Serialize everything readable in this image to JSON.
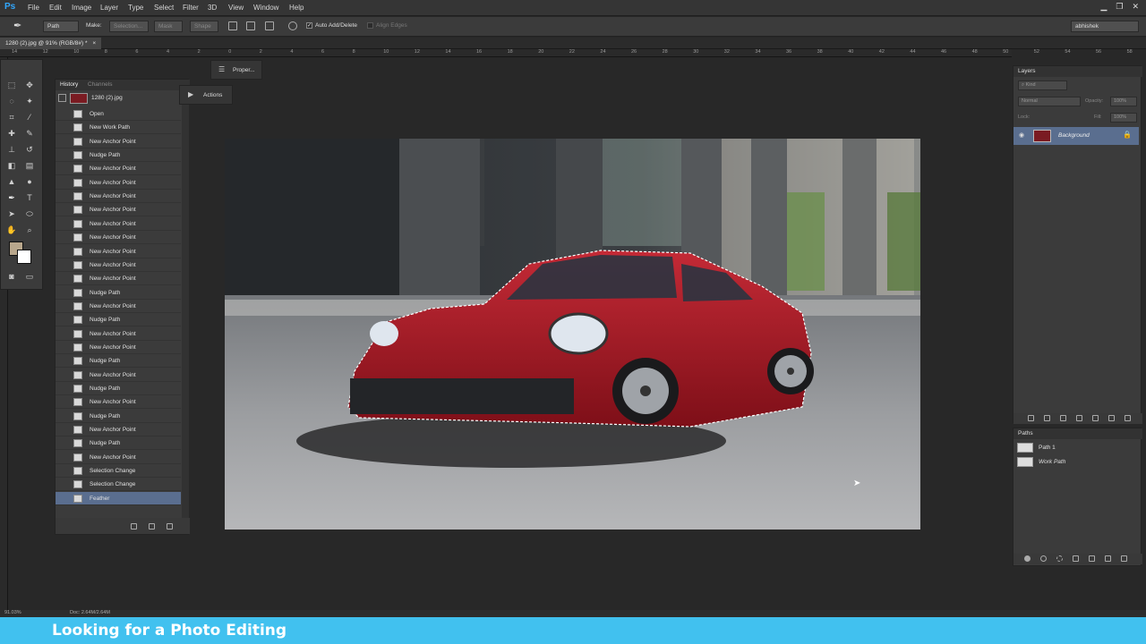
{
  "app": {
    "logo": "Ps",
    "user": "abhishek"
  },
  "menu": [
    "File",
    "Edit",
    "Image",
    "Layer",
    "Type",
    "Select",
    "Filter",
    "3D",
    "View",
    "Window",
    "Help"
  ],
  "options": {
    "mode_value": "Path",
    "make_label": "Make:",
    "selection_btn": "Selection...",
    "mask_btn": "Mask",
    "shape_btn": "Shape",
    "auto_add_delete": "Auto Add/Delete",
    "align_edges": "Align Edges"
  },
  "document": {
    "tab_title": "1280 (2).jpg @ 91% (RGB/8#) *",
    "close": "×"
  },
  "ruler_numbers": [
    "14",
    "12",
    "10",
    "8",
    "6",
    "4",
    "2",
    "0",
    "2",
    "4",
    "6",
    "8",
    "10",
    "12",
    "14",
    "16",
    "18",
    "20",
    "22",
    "24",
    "26",
    "28",
    "30",
    "32",
    "34",
    "36",
    "38",
    "40",
    "42",
    "44",
    "46",
    "48",
    "50",
    "52",
    "54",
    "56",
    "58"
  ],
  "history": {
    "tabs": [
      "History",
      "Channels"
    ],
    "snapshot": "1280 (2).jpg",
    "steps": [
      "Open",
      "New Work Path",
      "New Anchor Point",
      "Nudge Path",
      "New Anchor Point",
      "New Anchor Point",
      "New Anchor Point",
      "New Anchor Point",
      "New Anchor Point",
      "New Anchor Point",
      "New Anchor Point",
      "New Anchor Point",
      "New Anchor Point",
      "Nudge Path",
      "New Anchor Point",
      "Nudge Path",
      "New Anchor Point",
      "New Anchor Point",
      "Nudge Path",
      "New Anchor Point",
      "Nudge Path",
      "New Anchor Point",
      "Nudge Path",
      "New Anchor Point",
      "Nudge Path",
      "New Anchor Point",
      "Selection Change",
      "Selection Change",
      "Feather"
    ],
    "active_index": 28
  },
  "chips": {
    "properties": "Proper...",
    "actions": "Actions"
  },
  "layers": {
    "title": "Layers",
    "kind": "Kind",
    "blend": "Normal",
    "opacity_label": "Opacity:",
    "opacity": "100%",
    "lock_label": "Lock:",
    "fill_label": "Fill:",
    "fill": "100%",
    "items": [
      {
        "name": "Background"
      }
    ]
  },
  "paths": {
    "title": "Paths",
    "items": [
      {
        "name": "Path 1"
      },
      {
        "name": "Work Path"
      }
    ]
  },
  "status": {
    "zoom": "91.03%",
    "doc": "Doc: 2.64M/2.64M"
  },
  "banner": {
    "text": "Looking for a Photo Editing"
  },
  "colors": {
    "accent": "#41c1ef",
    "foreground": "#b9a78c",
    "background": "#ffffff",
    "car": "#b01c28"
  }
}
